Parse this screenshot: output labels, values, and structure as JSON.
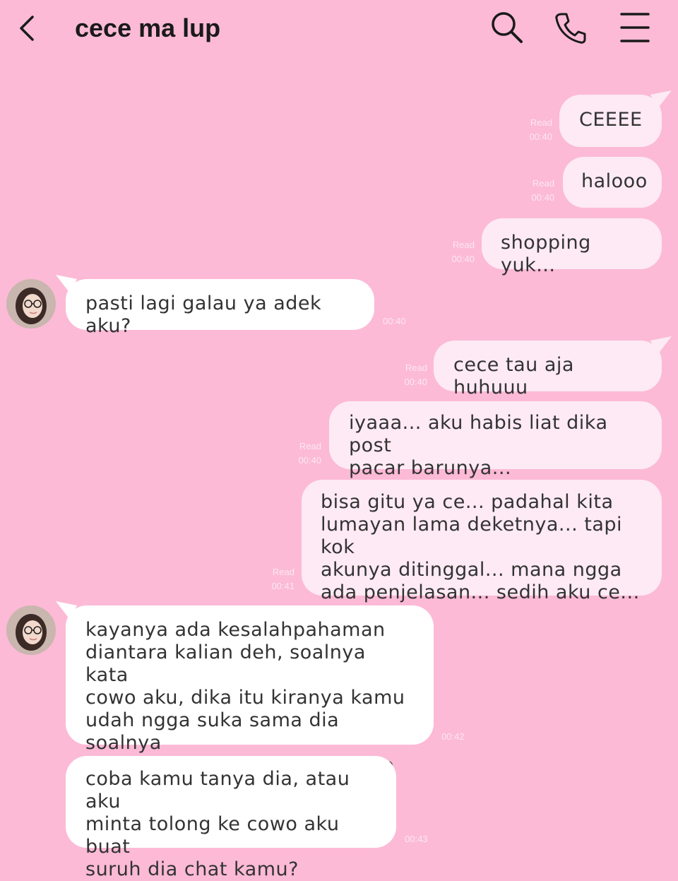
{
  "header": {
    "title": "cece ma lup",
    "back_icon": "chevron-left-icon",
    "search_icon": "search-icon",
    "call_icon": "phone-icon",
    "menu_icon": "menu-icon"
  },
  "colors": {
    "background": "#fcbad6",
    "outgoing_bubble": "#fdeaf4",
    "incoming_bubble": "#ffffff",
    "meta_text": "#fde7f1"
  },
  "messages": [
    {
      "direction": "out",
      "text": "CEEEE",
      "status": "Read",
      "time": "00:40"
    },
    {
      "direction": "out",
      "text": "halooo",
      "status": "Read",
      "time": "00:40"
    },
    {
      "direction": "out",
      "text": "shopping yuk...",
      "status": "Read",
      "time": "00:40"
    },
    {
      "direction": "in",
      "text": "pasti lagi galau ya adek aku?",
      "time": "00:40"
    },
    {
      "direction": "out",
      "text": "cece tau aja huhuuu",
      "status": "Read",
      "time": "00:40"
    },
    {
      "direction": "out",
      "text": "iyaaa... aku habis liat dika post\npacar barunya...",
      "status": "Read",
      "time": "00:40"
    },
    {
      "direction": "out",
      "text": "bisa gitu ya ce... padahal kita\nlumayan lama deketnya... tapi kok\nakunya ditinggal... mana ngga\nada penjelasan... sedih aku ce...",
      "status": "Read",
      "time": "00:41"
    },
    {
      "direction": "in",
      "text": "kayanya ada kesalahpahaman\ndiantara kalian deh, soalnya kata\ncowo aku, dika itu kiranya kamu\nudah ngga suka sama dia soalnya\nkamu deket banget sama cowo lain",
      "time": "00:42"
    },
    {
      "direction": "in",
      "text": "coba kamu tanya dia, atau aku\nminta tolong ke cowo aku buat\nsuruh dia chat kamu?",
      "time": "00:43"
    }
  ]
}
